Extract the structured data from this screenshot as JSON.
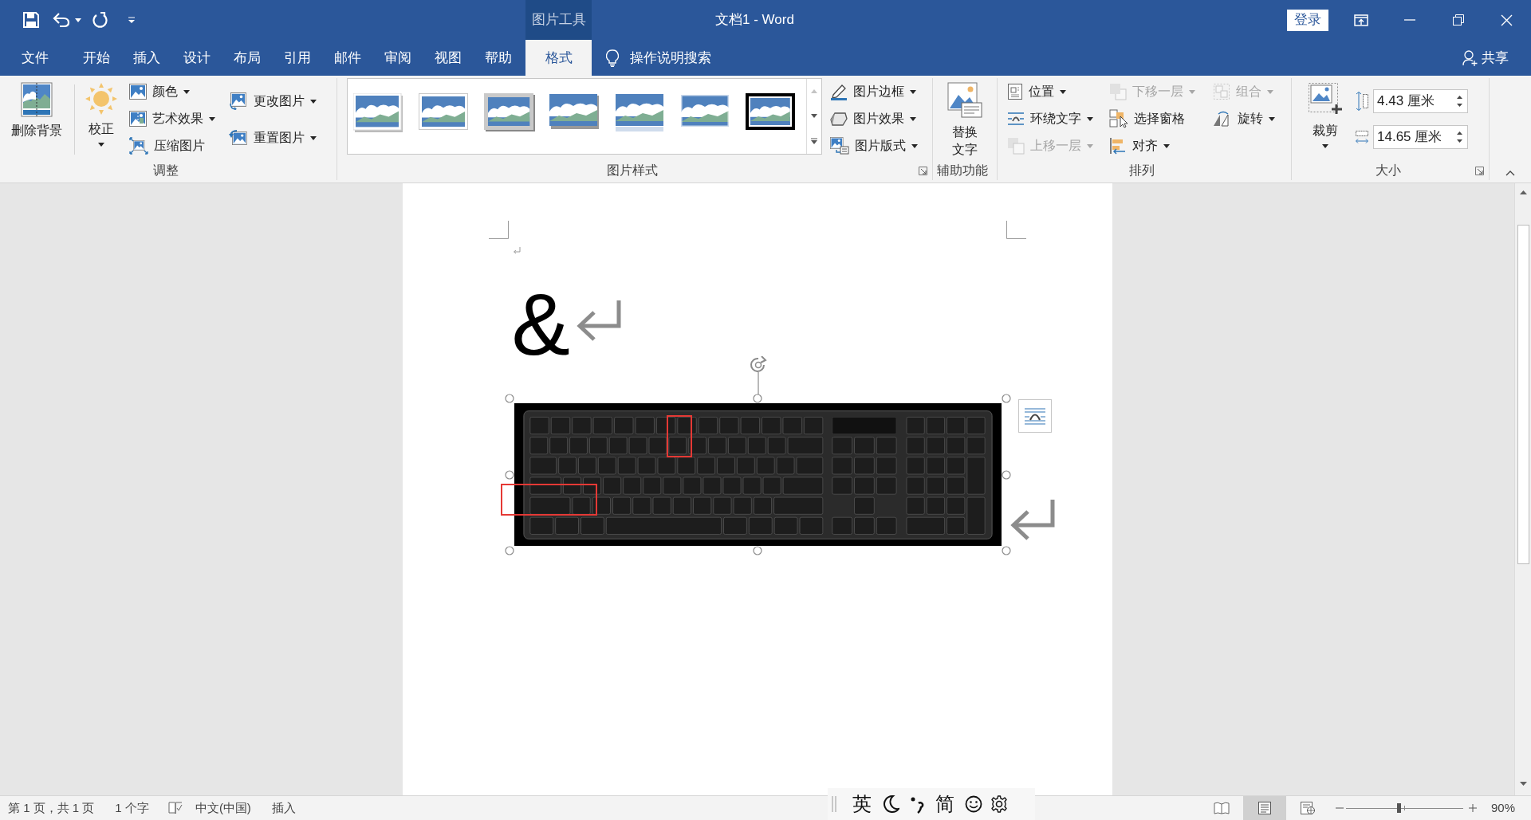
{
  "window": {
    "tool_group": "图片工具",
    "title": "文档1 - Word",
    "sign_in": "登录"
  },
  "tabs": [
    {
      "label": "文件",
      "kind": "file",
      "selected": false
    },
    {
      "label": "开始",
      "kind": "standard",
      "selected": false
    },
    {
      "label": "插入",
      "kind": "standard",
      "selected": false
    },
    {
      "label": "设计",
      "kind": "standard",
      "selected": false
    },
    {
      "label": "布局",
      "kind": "standard",
      "selected": false
    },
    {
      "label": "引用",
      "kind": "standard",
      "selected": false
    },
    {
      "label": "邮件",
      "kind": "standard",
      "selected": false
    },
    {
      "label": "审阅",
      "kind": "standard",
      "selected": false
    },
    {
      "label": "视图",
      "kind": "standard",
      "selected": false
    },
    {
      "label": "帮助",
      "kind": "standard",
      "selected": false
    },
    {
      "label": "格式",
      "kind": "contextual",
      "selected": true
    }
  ],
  "tell_me": "操作说明搜索",
  "share": "共享",
  "ribbon": {
    "adjust": {
      "label": "调整",
      "large_buttons": [
        {
          "label": "删除背景",
          "dropdown": false
        },
        {
          "label": "校正",
          "dropdown": true
        }
      ],
      "buttons": [
        {
          "label": "颜色",
          "dropdown": true
        },
        {
          "label": "艺术效果",
          "dropdown": true
        },
        {
          "label": "压缩图片",
          "dropdown": false
        },
        {
          "label": "更改图片",
          "dropdown": true
        },
        {
          "label": "重置图片",
          "dropdown": true
        }
      ]
    },
    "picture_styles": {
      "label": "图片样式",
      "buttons": [
        {
          "label": "图片边框",
          "dropdown": true
        },
        {
          "label": "图片效果",
          "dropdown": true
        },
        {
          "label": "图片版式",
          "dropdown": true
        }
      ]
    },
    "accessibility": {
      "label": "辅助功能",
      "large_buttons": [
        {
          "label": "替换文字",
          "dropdown": false
        }
      ]
    },
    "arrange": {
      "label": "排列",
      "buttons": [
        {
          "label": "位置",
          "dropdown": true,
          "disabled": false
        },
        {
          "label": "环绕文字",
          "dropdown": true,
          "disabled": false
        },
        {
          "label": "上移一层",
          "dropdown": true,
          "disabled": true
        },
        {
          "label": "下移一层",
          "dropdown": true,
          "disabled": true
        },
        {
          "label": "选择窗格",
          "dropdown": false,
          "disabled": false
        },
        {
          "label": "对齐",
          "dropdown": true,
          "disabled": false
        },
        {
          "label": "组合",
          "dropdown": true,
          "disabled": true
        },
        {
          "label": "旋转",
          "dropdown": true,
          "disabled": false
        }
      ]
    },
    "size": {
      "label": "大小",
      "large_buttons": [
        {
          "label": "裁剪",
          "dropdown": true
        }
      ],
      "height": "4.43 厘米",
      "width": "14.65 厘米"
    }
  },
  "document": {
    "text": "&"
  },
  "ime": {
    "mode": "英",
    "script": "简"
  },
  "status_bar": {
    "page": "第 1 页，共 1 页",
    "words": "1 个字",
    "language": "中文(中国)",
    "mode": "插入",
    "views": [
      {
        "selected": false
      },
      {
        "selected": true
      },
      {
        "selected": false
      }
    ],
    "zoom": {
      "level": 0.45,
      "reading": "90%"
    }
  }
}
